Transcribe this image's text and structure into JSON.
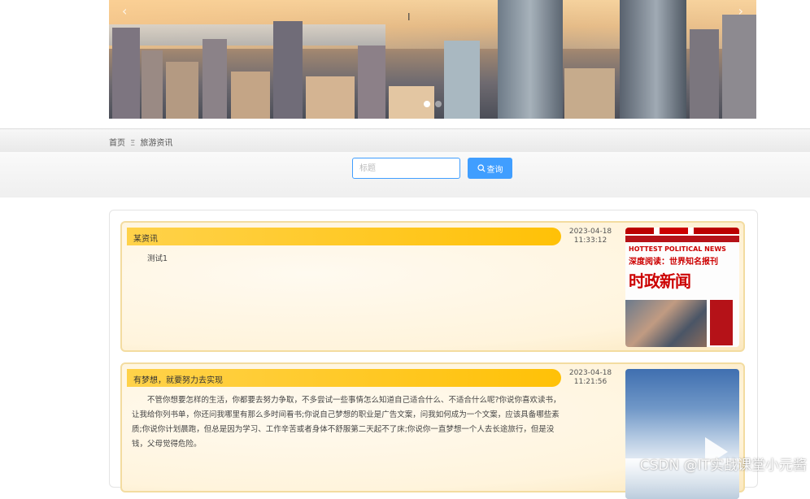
{
  "banner": {
    "prev_arrow": "‹",
    "next_arrow": "›",
    "slides": 2,
    "active_slide": 1
  },
  "breadcrumb": {
    "home": "首页",
    "separator": "Ξ",
    "current": "旅游资讯"
  },
  "search": {
    "placeholder": "标题",
    "value": "",
    "button_label": "查询",
    "button_color": "#409eff"
  },
  "news": [
    {
      "title": "某资讯",
      "date": "2023-04-18",
      "time": "11:33:12",
      "summary": "测试1",
      "thumbnail": {
        "kind": "magazine-cover",
        "line1": "HOTTEST POLITICAL NEWS",
        "line2": "深度阅读：世界知名报刊",
        "line3": "时政新闻"
      }
    },
    {
      "title": "有梦想，就要努力去实现",
      "date": "2023-04-18",
      "time": "11:21:56",
      "summary": "不管你想要怎样的生活，你都要去努力争取，不多尝试一些事情怎么知道自己适合什么、不适合什么呢?你说你喜欢读书，让我给你列书单，你还问我哪里有那么多时间看书;你说自己梦想的职业是广告文案，问我如何成为一个文案，应该具备哪些素质;你说你计划晨跑，但总是因为学习、工作辛苦或者身体不舒服第二天起不了床;你说你一直梦想一个人去长途旅行，但是没钱，父母觉得危险。",
      "thumbnail": {
        "kind": "mountain-video",
        "watermark": "CSDN @IT实战课堂小元酱"
      }
    }
  ],
  "colors": {
    "title_bar": "#ffc107",
    "card_border": "#f3dca0",
    "accent": "#409eff"
  }
}
